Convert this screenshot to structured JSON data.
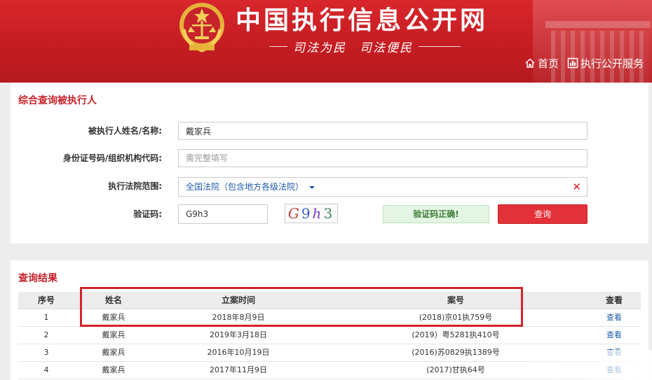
{
  "header": {
    "site_title": "中国执行信息公开网",
    "slogan": "司法为民　司法便民",
    "nav": [
      {
        "label": "首页",
        "icon": "home-icon"
      },
      {
        "label": "执行公开服务",
        "icon": "chart-icon"
      }
    ]
  },
  "search": {
    "title": "综合查询被执行人",
    "name_label": "被执行人姓名/名称:",
    "name_value": "戴家兵",
    "id_label": "身份证号码/组织机构代码:",
    "id_placeholder": "需完整填写",
    "court_label": "执行法院范围:",
    "court_value": "全国法院（包含地方各级法院）",
    "captcha_label": "验证码:",
    "captcha_value": "G9h3",
    "captcha_image_text": [
      "G",
      "9",
      "h",
      "3"
    ],
    "captcha_ok": "验证码正确!",
    "search_button": "查询"
  },
  "results": {
    "title": "查询结果",
    "columns": [
      "序号",
      "姓名",
      "立案时间",
      "案号",
      "查看"
    ],
    "rows": [
      {
        "no": "1",
        "name": "戴家兵",
        "date": "2018年8月9日",
        "case": "(2018)京01执759号",
        "view": "查看"
      },
      {
        "no": "2",
        "name": "戴家兵",
        "date": "2019年3月18日",
        "case": "(2019）粤5281执410号",
        "view": "查看"
      },
      {
        "no": "3",
        "name": "戴家兵",
        "date": "2016年10月19日",
        "case": "(2016)苏0829执1389号",
        "view": "查看"
      },
      {
        "no": "4",
        "name": "戴家兵",
        "date": "2017年11月9日",
        "case": "(2017)甘执64号",
        "view": "查看"
      }
    ]
  },
  "colors": {
    "brand_red": "#c8232b",
    "header_red": "#d8262c",
    "link_blue": "#1f5ba8",
    "success_green": "#3a7d34"
  }
}
